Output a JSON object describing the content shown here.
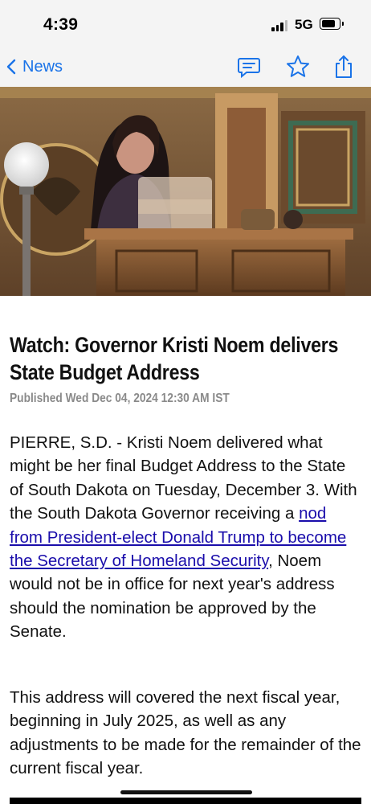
{
  "status_bar": {
    "time": "4:39",
    "network": "5G"
  },
  "nav": {
    "back_label": "News"
  },
  "article": {
    "headline": "Watch: Governor Kristi Noem delivers State Budget Address",
    "published": "Published Wed Dec 04, 2024 12:30 AM IST",
    "p1_start": "PIERRE, S.D. - Kristi Noem delivered what might be her final Budget Address to the State of South Dakota on Tuesday, December 3. With the South Dakota Governor receiving a ",
    "p1_link": "nod from President-elect Donald Trump to become the Secretary of Homeland Security",
    "p1_end": ", Noem would not be in office for next year's address should the nomination be approved by the Senate.",
    "p2": "This address will covered the next fiscal year, beginning in July 2025, as well as any adjustments to be made for the remainder of the current fiscal year."
  },
  "colors": {
    "accent": "#1a73e8",
    "link": "#1a0dab",
    "nav_bg": "#f4f4f4"
  }
}
